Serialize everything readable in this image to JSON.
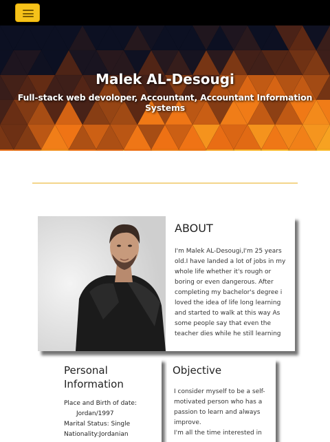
{
  "header": {
    "menu_icon": "hamburger-icon",
    "accent_color": "#f6c21a"
  },
  "hero": {
    "title": "Malek AL-Desougi",
    "subtitle": "Full-stack web devoloper, Accountant, Accountant Information Systems"
  },
  "about": {
    "title": "ABOUT",
    "text": "I'm Malek AL-Desougi,I'm 25 years old.I have landed a lot of jobs in my whole life whether it's rough or boring or even dangerous. After completing my bachelor's degree i loved the idea of life long learning and started to walk at this way As some people say that even the teacher dies while he still learning"
  },
  "personal": {
    "title": "Personal Information",
    "birth_label": "Place and Birth of date:",
    "birth_value": "Jordan/1997",
    "marital": "Marital Status: Single",
    "nationality": "Nationality:Jordanian"
  },
  "objective": {
    "title": "Objective",
    "text": "I consider myself to be a self-motivated person who has a passion to learn and always improve.",
    "text2": "I'm all the time interested in"
  }
}
